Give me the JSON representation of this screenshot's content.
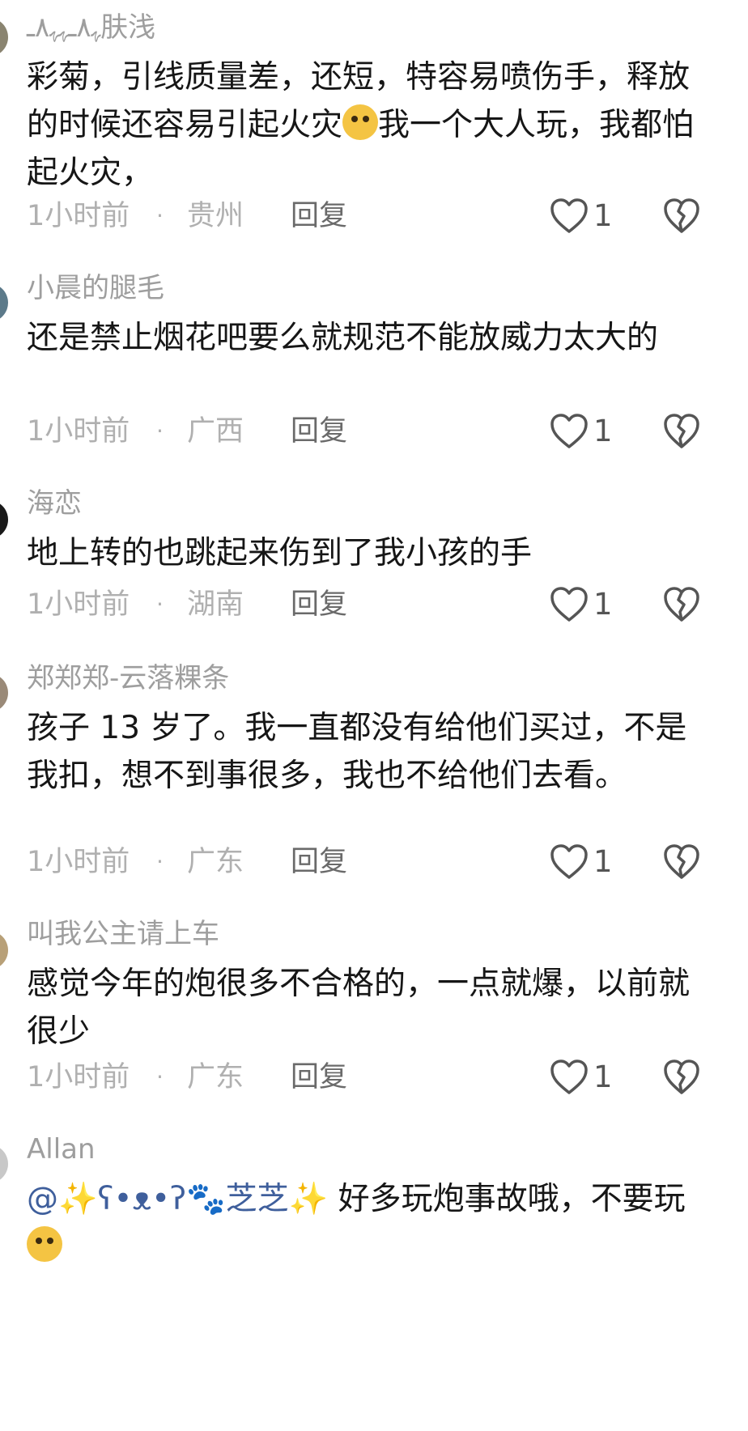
{
  "comments": [
    {
      "username": "ﮩ٨ـﮩﮩ٨ـ肤浅",
      "text": "彩菊，引线质量差，还短，特容易喷伤手，释放的时候还容易引起火灾",
      "text_after_emoji": "我一个大人玩，我都怕起火灾，",
      "emoji": "laughing-crying-emoji",
      "time": "1小时前",
      "location": "贵州",
      "reply": "回复",
      "likes": "1"
    },
    {
      "username": "小晨的腿毛",
      "text": "还是禁止烟花吧要么就规范不能放威力太大的",
      "time": "1小时前",
      "location": "广西",
      "reply": "回复",
      "likes": "1"
    },
    {
      "username": "海恋",
      "text": "地上转的也跳起来伤到了我小孩的手",
      "time": "1小时前",
      "location": "湖南",
      "reply": "回复",
      "likes": "1"
    },
    {
      "username": "郑郑郑-云落粿条",
      "text": "孩子 13 岁了。我一直都没有给他们买过，不是我扣，想不到事很多，我也不给他们去看。",
      "time": "1小时前",
      "location": "广东",
      "reply": "回复",
      "likes": "1"
    },
    {
      "username": "叫我公主请上车",
      "text": "感觉今年的炮很多不合格的，一点就爆，以前就很少",
      "time": "1小时前",
      "location": "广东",
      "reply": "回复",
      "likes": "1"
    },
    {
      "username": "Allan",
      "mention": "@✨ʕ•ᴥ•ʔ🐾芝芝✨",
      "text": " 好多玩炮事故哦，不要玩",
      "emoji": "flushed-emoji"
    }
  ],
  "separator": "·",
  "colors": {
    "username": "#9e9e9e",
    "text": "#161616",
    "meta": "#b0b0b0",
    "reply": "#6a6a6a",
    "mention": "#3f5f9c",
    "icon_stroke": "#555555"
  }
}
